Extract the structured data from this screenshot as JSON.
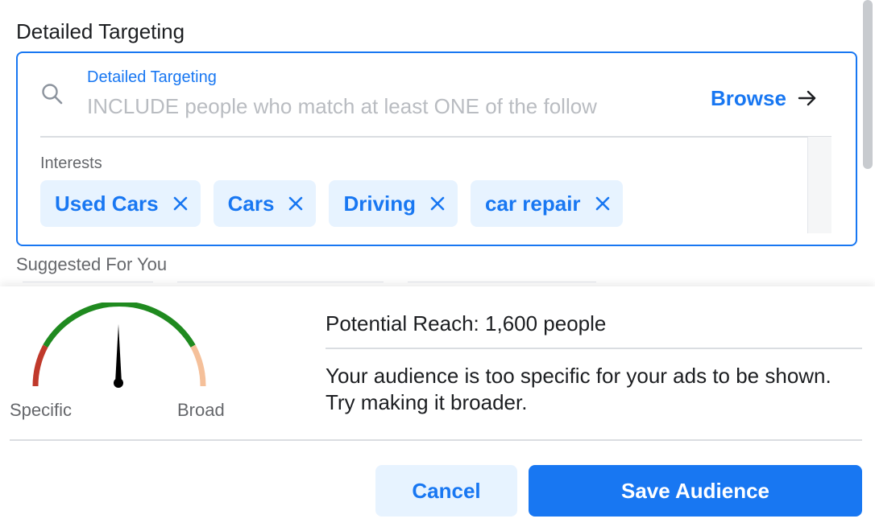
{
  "section": {
    "title": "Detailed Targeting"
  },
  "targeting": {
    "field_label": "Detailed Targeting",
    "placeholder": "INCLUDE people who match at least ONE of the follow",
    "browse_label": "Browse",
    "interests_label": "Interests",
    "interests": [
      "Used Cars",
      "Cars",
      "Driving",
      "car repair"
    ]
  },
  "suggested": {
    "label": "Suggested For You"
  },
  "reach": {
    "gauge": {
      "specific_label": "Specific",
      "broad_label": "Broad"
    },
    "potential_reach": "Potential Reach: 1,600 people",
    "warning": "Your audience is too specific for your ads to be shown. Try making it broader."
  },
  "actions": {
    "cancel_label": "Cancel",
    "save_label": "Save Audience"
  },
  "colors": {
    "accent": "#1877f2",
    "chip_bg": "#e7f3ff",
    "gauge_low": "#c0392b",
    "gauge_good": "#1f8a1f",
    "gauge_high": "#f5c09a"
  },
  "icons": {
    "search": "search-icon",
    "browse": "arrow-right-icon",
    "remove": "close-icon",
    "gauge_needle": "needle-icon"
  }
}
